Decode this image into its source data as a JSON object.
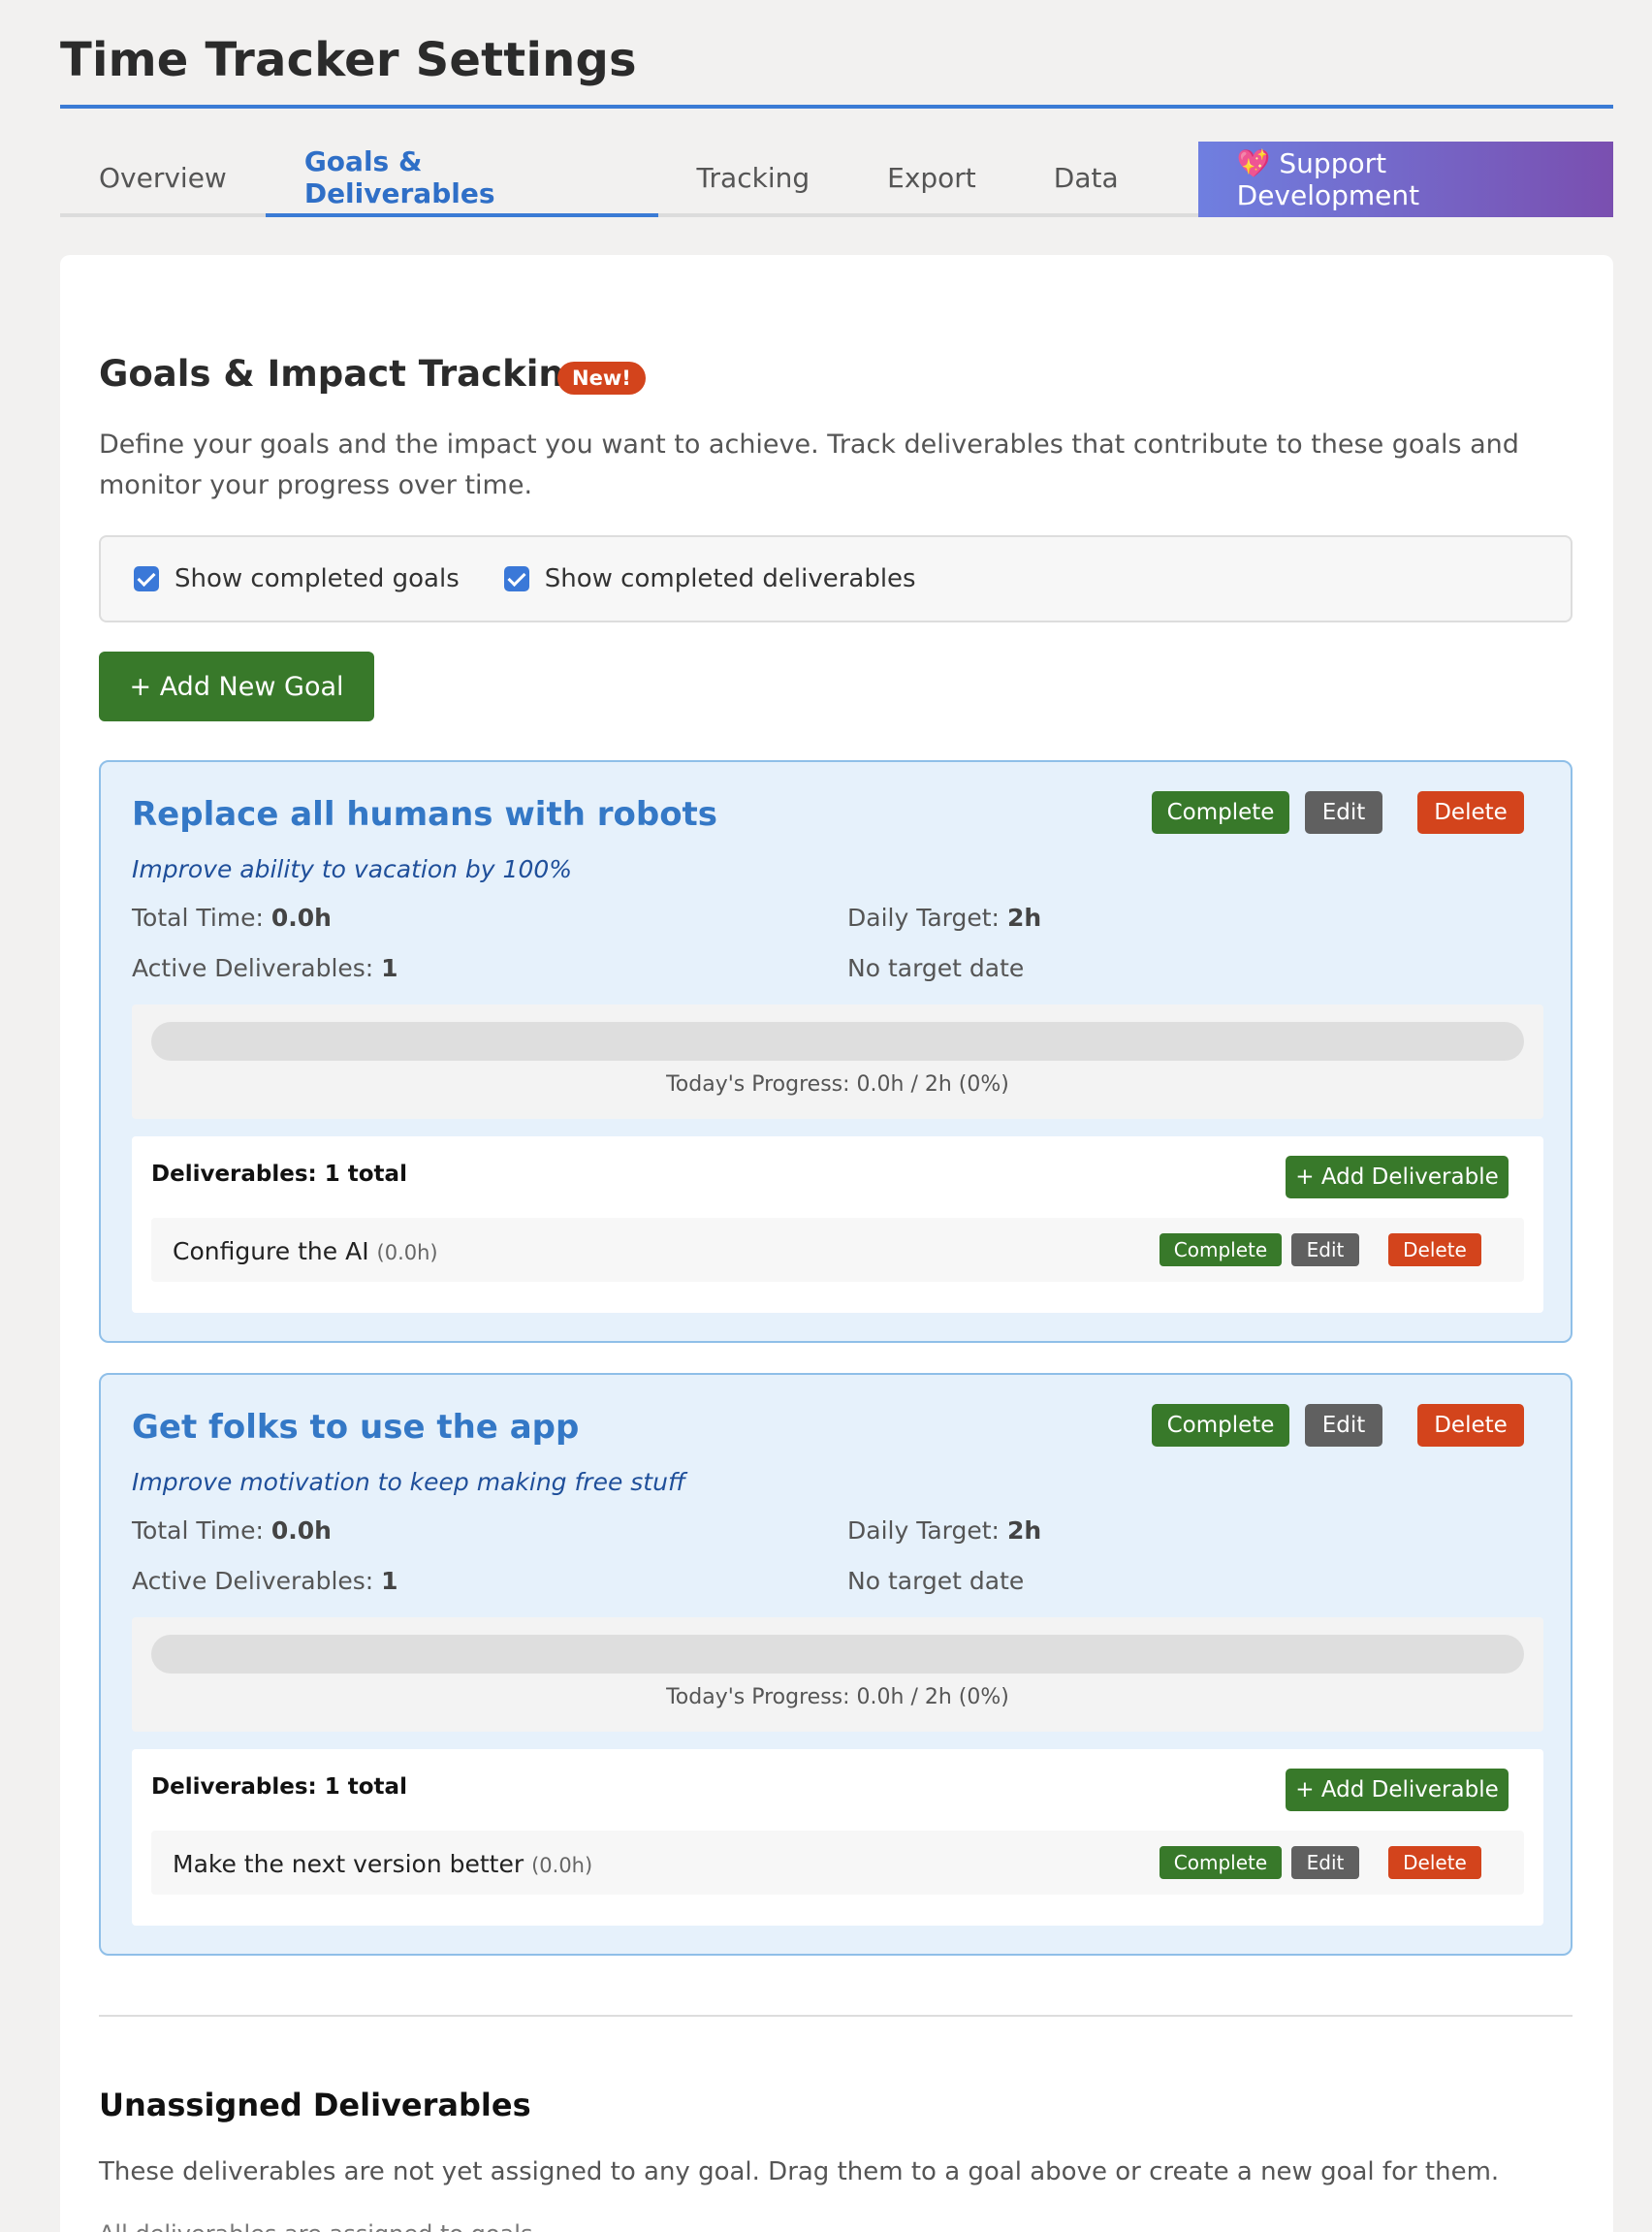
{
  "page": {
    "title": "Time Tracker Settings"
  },
  "tabs": [
    {
      "label": "Overview"
    },
    {
      "label": "Goals & Deliverables"
    },
    {
      "label": "Tracking"
    },
    {
      "label": "Export"
    },
    {
      "label": "Data"
    },
    {
      "label": "💖 Support Development"
    }
  ],
  "section": {
    "title": "Goals & Impact Tracking",
    "badge": "New!",
    "description": "Define your goals and the impact you want to achieve. Track deliverables that contribute to these goals and monitor your progress over time."
  },
  "filters": {
    "show_completed_goals": {
      "label": "Show completed goals",
      "checked": true
    },
    "show_completed_deliverables": {
      "label": "Show completed deliverables",
      "checked": true
    }
  },
  "add_goal_label": "+ Add New Goal",
  "goals": [
    {
      "title": "Replace all humans with robots",
      "impact": "Improve ability to vacation by 100%",
      "total_time_label": "Total Time:",
      "total_time": "0.0h",
      "daily_target_label": "Daily Target:",
      "daily_target": "2h",
      "active_deliverables_label": "Active Deliverables:",
      "active_deliverables": "1",
      "target_date": "No target date",
      "progress_fraction": 0,
      "progress_text": "Today's Progress: 0.0h / 2h (0%)",
      "deliverables_header": "Deliverables: 1 total",
      "add_deliverable_label": "+ Add Deliverable",
      "actions": {
        "complete": "Complete",
        "edit": "Edit",
        "delete": "Delete"
      },
      "deliverables": [
        {
          "name": "Configure the AI",
          "hours": "(0.0h)",
          "complete": "Complete",
          "edit": "Edit",
          "delete": "Delete"
        }
      ]
    },
    {
      "title": "Get folks to use the app",
      "impact": "Improve motivation to keep making free stuff",
      "total_time_label": "Total Time:",
      "total_time": "0.0h",
      "daily_target_label": "Daily Target:",
      "daily_target": "2h",
      "active_deliverables_label": "Active Deliverables:",
      "active_deliverables": "1",
      "target_date": "No target date",
      "progress_fraction": 0,
      "progress_text": "Today's Progress: 0.0h / 2h (0%)",
      "deliverables_header": "Deliverables: 1 total",
      "add_deliverable_label": "+ Add Deliverable",
      "actions": {
        "complete": "Complete",
        "edit": "Edit",
        "delete": "Delete"
      },
      "deliverables": [
        {
          "name": "Make the next version better",
          "hours": "(0.0h)",
          "complete": "Complete",
          "edit": "Edit",
          "delete": "Delete"
        }
      ]
    }
  ],
  "unassigned": {
    "title": "Unassigned Deliverables",
    "description": "These deliverables are not yet assigned to any goal. Drag them to a goal above or create a new goal for them.",
    "empty_text": "All deliverables are assigned to goals."
  },
  "colors": {
    "accent": "#3b7bd5",
    "success": "#38792a",
    "danger": "#d3441c",
    "neutral": "#606060"
  }
}
